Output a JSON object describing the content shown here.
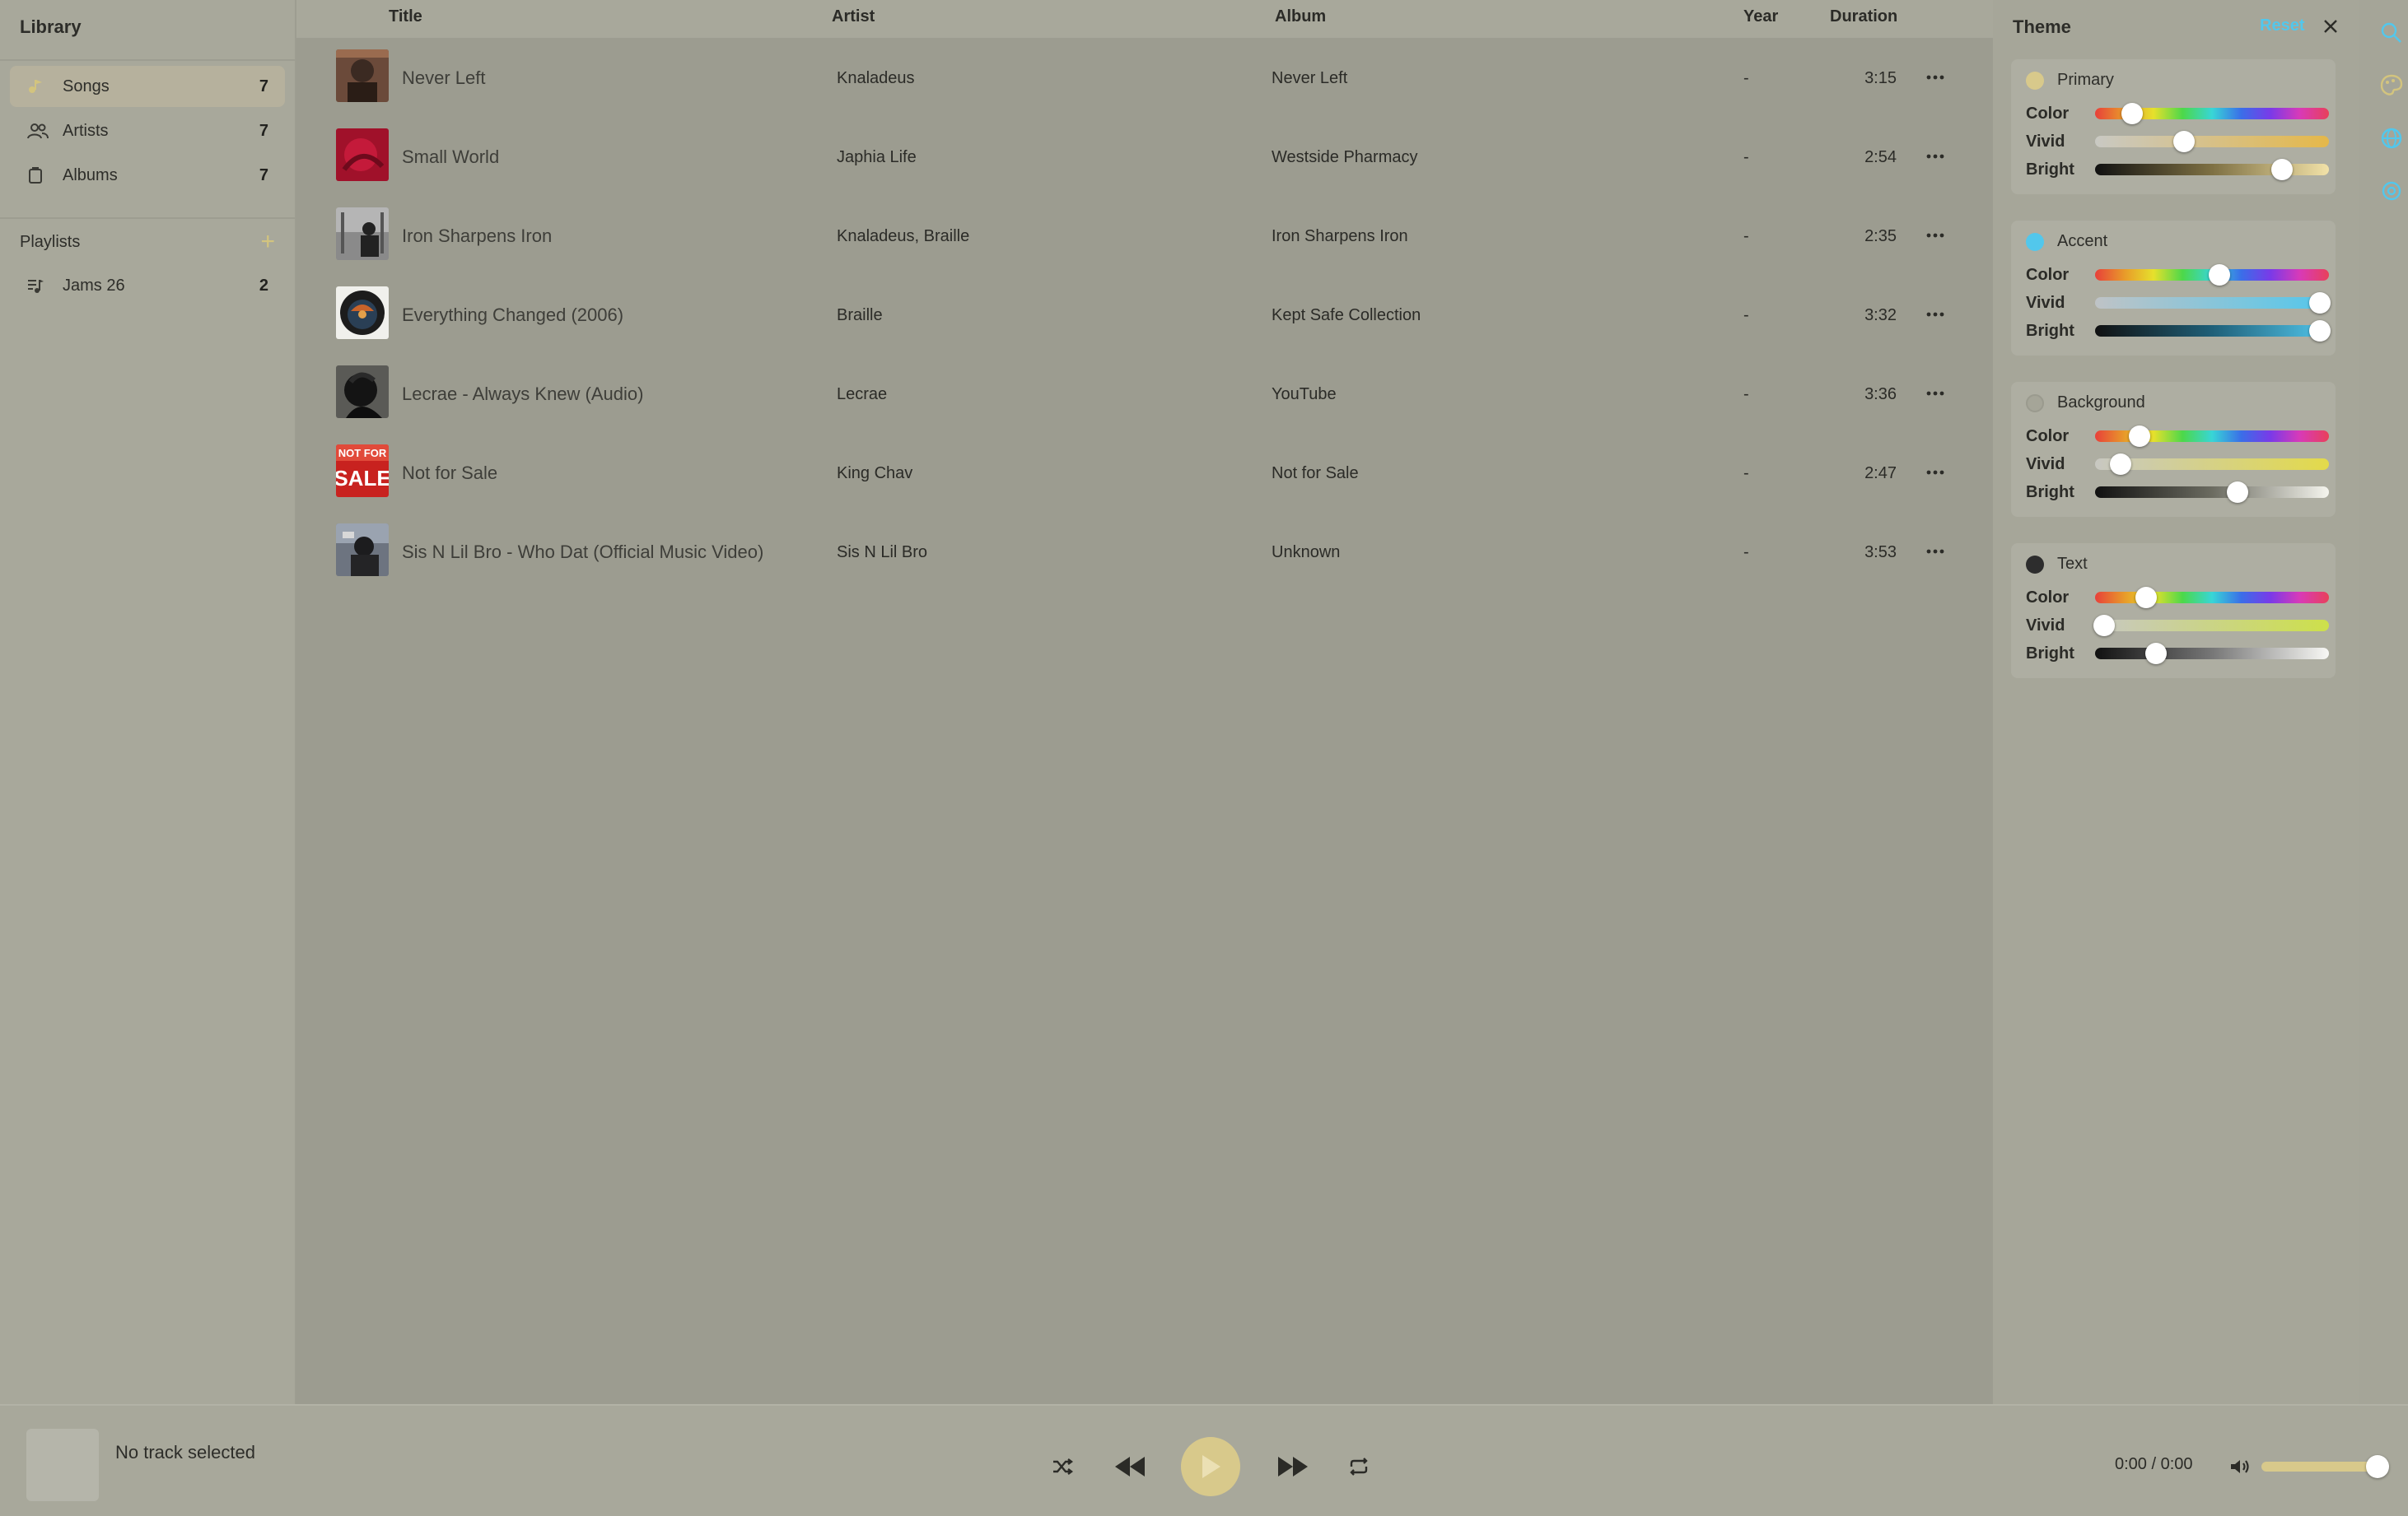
{
  "sidebar": {
    "title": "Library",
    "nav": [
      {
        "label": "Songs",
        "count": "7",
        "icon": "songs-icon"
      },
      {
        "label": "Artists",
        "count": "7",
        "icon": "artists-icon"
      },
      {
        "label": "Albums",
        "count": "7",
        "icon": "albums-icon"
      }
    ],
    "playlists_title": "Playlists",
    "playlists": [
      {
        "label": "Jams 26",
        "count": "2",
        "icon": "playlist-icon"
      }
    ]
  },
  "columns": {
    "title": "Title",
    "artist": "Artist",
    "album": "Album",
    "year": "Year",
    "duration": "Duration"
  },
  "songs": [
    {
      "title": "Never Left",
      "artist": "Knaladeus",
      "album": "Never Left",
      "year": "-",
      "duration": "3:15"
    },
    {
      "title": "Small World",
      "artist": "Japhia Life",
      "album": "Westside Pharmacy",
      "year": "-",
      "duration": "2:54"
    },
    {
      "title": "Iron Sharpens Iron",
      "artist": "Knaladeus, Braille",
      "album": "Iron Sharpens Iron",
      "year": "-",
      "duration": "2:35"
    },
    {
      "title": "Everything Changed (2006)",
      "artist": "Braille",
      "album": "Kept Safe Collection",
      "year": "-",
      "duration": "3:32"
    },
    {
      "title": "Lecrae - Always Knew (Audio)",
      "artist": "Lecrae",
      "album": "YouTube",
      "year": "-",
      "duration": "3:36"
    },
    {
      "title": "Not for Sale",
      "artist": "King Chav",
      "album": "Not for Sale",
      "year": "-",
      "duration": "2:47"
    },
    {
      "title": "Sis N Lil Bro - Who Dat (Official Music Video)",
      "artist": "Sis N Lil Bro",
      "album": "Unknown",
      "year": "-",
      "duration": "3:53"
    }
  ],
  "thumb_art": {
    "not_for_sale_top": "NOT FOR",
    "not_for_sale_bottom": "SALE"
  },
  "theme": {
    "title": "Theme",
    "reset_label": "Reset",
    "slider_labels": {
      "color": "Color",
      "vivid": "Vivid",
      "bright": "Bright"
    },
    "groups": [
      {
        "name": "Primary",
        "swatch": "#d8c98b",
        "color": 0.16,
        "vivid": 0.38,
        "bright": 0.8
      },
      {
        "name": "Accent",
        "swatch": "#52c7ec",
        "color": 0.53,
        "vivid": 0.96,
        "bright": 0.96
      },
      {
        "name": "Background",
        "swatch": "#a5a598",
        "color": 0.19,
        "vivid": 0.11,
        "bright": 0.61
      },
      {
        "name": "Text",
        "swatch": "#2d2d2d",
        "color": 0.22,
        "vivid": 0.04,
        "bright": 0.26
      }
    ]
  },
  "player": {
    "track_name": "No track selected",
    "time": "0:00 / 0:00",
    "volume": 0.98,
    "controls": [
      "shuffle-icon",
      "previous-icon",
      "play-icon",
      "next-icon",
      "repeat-icon",
      "volume-icon"
    ]
  },
  "colors": {
    "accent": "#52c7ec",
    "primary": "#d8c98b"
  }
}
